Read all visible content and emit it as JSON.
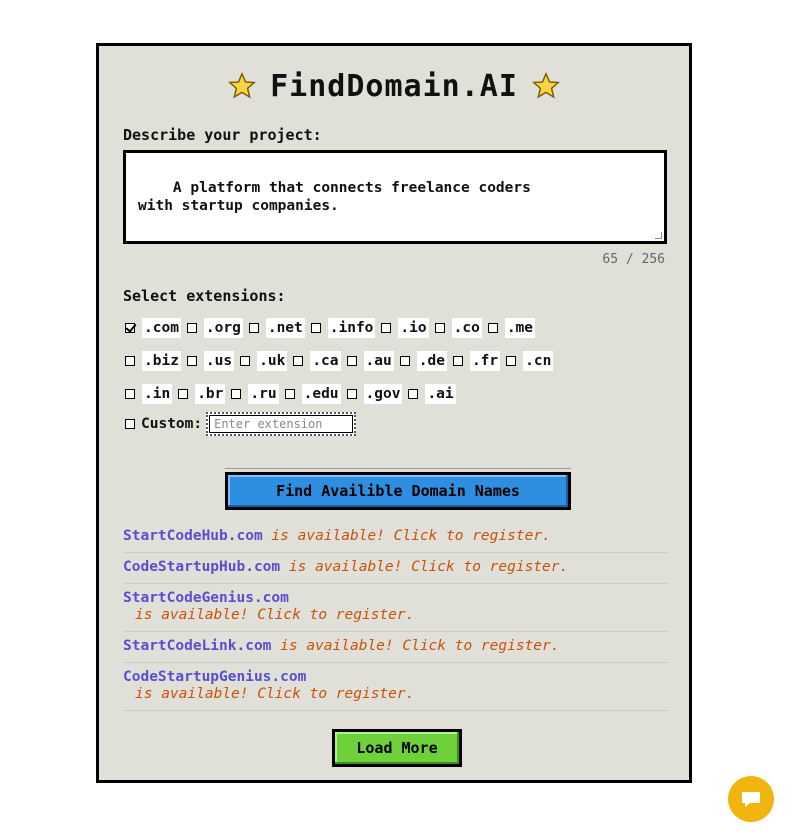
{
  "header": {
    "title": "FindDomain.AI",
    "star_icon": "star-icon"
  },
  "description": {
    "label": "Describe your project:",
    "value": "A platform that connects freelance coders\nwith startup companies.",
    "char_count": "65 / 256"
  },
  "extensions": {
    "label": "Select extensions:",
    "rows": [
      [
        {
          "label": ".com",
          "checked": true
        },
        {
          "label": ".org",
          "checked": false
        },
        {
          "label": ".net",
          "checked": false
        },
        {
          "label": ".info",
          "checked": false
        },
        {
          "label": ".io",
          "checked": false
        },
        {
          "label": ".co",
          "checked": false
        },
        {
          "label": ".me",
          "checked": false
        }
      ],
      [
        {
          "label": ".biz",
          "checked": false
        },
        {
          "label": ".us",
          "checked": false
        },
        {
          "label": ".uk",
          "checked": false
        },
        {
          "label": ".ca",
          "checked": false
        },
        {
          "label": ".au",
          "checked": false
        },
        {
          "label": ".de",
          "checked": false
        },
        {
          "label": ".fr",
          "checked": false
        },
        {
          "label": ".cn",
          "checked": false
        }
      ],
      [
        {
          "label": ".in",
          "checked": false
        },
        {
          "label": ".br",
          "checked": false
        },
        {
          "label": ".ru",
          "checked": false
        },
        {
          "label": ".edu",
          "checked": false
        },
        {
          "label": ".gov",
          "checked": false
        },
        {
          "label": ".ai",
          "checked": false
        }
      ]
    ],
    "custom_label": "Custom:",
    "custom_placeholder": "Enter extension"
  },
  "find_button_label": "Find Availible Domain Names",
  "results": [
    {
      "domain": "StartCodeHub.com",
      "status": "is available! Click to register.",
      "wrap": false
    },
    {
      "domain": "CodeStartupHub.com",
      "status": "is available! Click to register.",
      "wrap": false
    },
    {
      "domain": "StartCodeGenius.com",
      "status": "is available! Click to register.",
      "wrap": true
    },
    {
      "domain": "StartCodeLink.com",
      "status": "is available! Click to register.",
      "wrap": false
    },
    {
      "domain": "CodeStartupGenius.com",
      "status": "is available! Click to register.",
      "wrap": true
    }
  ],
  "load_more_label": "Load More",
  "colors": {
    "panel_bg": "#e0dfd8",
    "find_button": "#2e8fe0",
    "load_button": "#6fd13a",
    "domain_text": "#5a4ed0",
    "status_text": "#c8530c",
    "chat_bubble": "#f2b40f",
    "star": "#f5d442"
  },
  "chat": {
    "icon": "chat-icon"
  }
}
